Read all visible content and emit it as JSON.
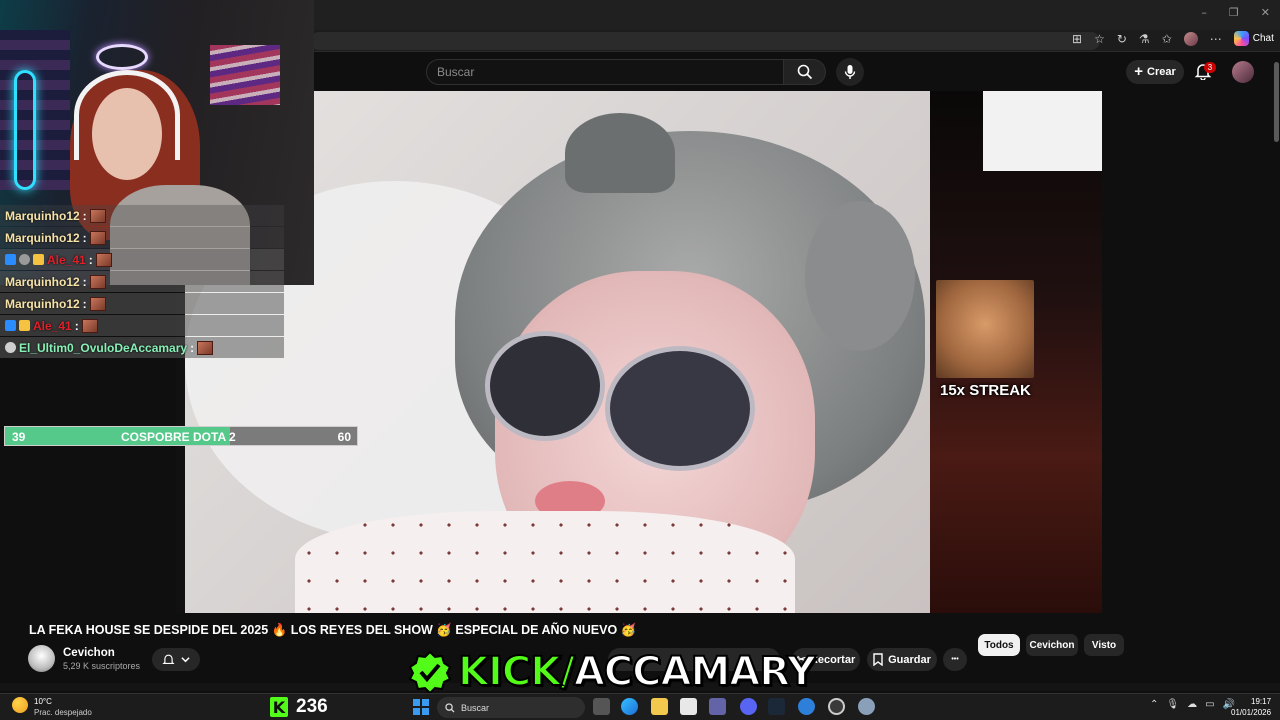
{
  "browser": {
    "copilot_label": "Chat",
    "controls": {
      "minimize": "–",
      "restore": "❐",
      "close": "✕"
    }
  },
  "youtube_header": {
    "search_placeholder": "Buscar",
    "create_label": "Crear",
    "notification_count": "3"
  },
  "stream_overlay": {
    "streak_text": "15x STREAK",
    "chat": [
      {
        "name": "Marquinho12",
        "color": "#f7e3a8",
        "badges": []
      },
      {
        "name": "Marquinho12",
        "color": "#f7e3a8",
        "badges": []
      },
      {
        "name": "Ale_41",
        "color": "#e0202a",
        "badges": [
          "blue",
          "gray",
          "gold"
        ]
      },
      {
        "name": "Marquinho12",
        "color": "#f7e3a8",
        "badges": []
      },
      {
        "name": "Marquinho12",
        "color": "#f7e3a8",
        "badges": []
      },
      {
        "name": "Ale_41",
        "color": "#e0202a",
        "badges": [
          "blue",
          "gold"
        ]
      },
      {
        "name": "El_Ultim0_OvuloDeAccamary",
        "color": "#86f0b6",
        "badges": [
          "gray"
        ]
      }
    ],
    "chat_separator": ":",
    "poll": {
      "left_value": "39",
      "title": "COSPOBRE DOTA 2",
      "right_value": "60",
      "fill_fraction": 0.64
    },
    "kick_prefix": "KICK/",
    "kick_channel": "ACCAMARY",
    "kick_viewers": "236",
    "kick_logo": "K"
  },
  "video": {
    "title": "LA FEKA HOUSE SE DESPIDE DEL 2025 🔥 LOS REYES DEL SHOW 🥳 ESPECIAL DE AÑO NUEVO 🥳",
    "channel_name": "Cevichon",
    "subscribers": "5,29 K suscriptores",
    "actions": {
      "clip": "Recortar",
      "save": "Guardar",
      "more": "•••"
    }
  },
  "filters": [
    "Todos",
    "Cevichon",
    "Visto"
  ],
  "taskbar": {
    "weather_temp": "10°C",
    "weather_desc": "Prac. despejado",
    "search_placeholder": "Buscar",
    "time": "19:17",
    "date": "01/01/2026"
  },
  "colors": {
    "kick_green": "#53fc18",
    "accent_red": "#cc0000",
    "poll_green": "#54c98a"
  }
}
